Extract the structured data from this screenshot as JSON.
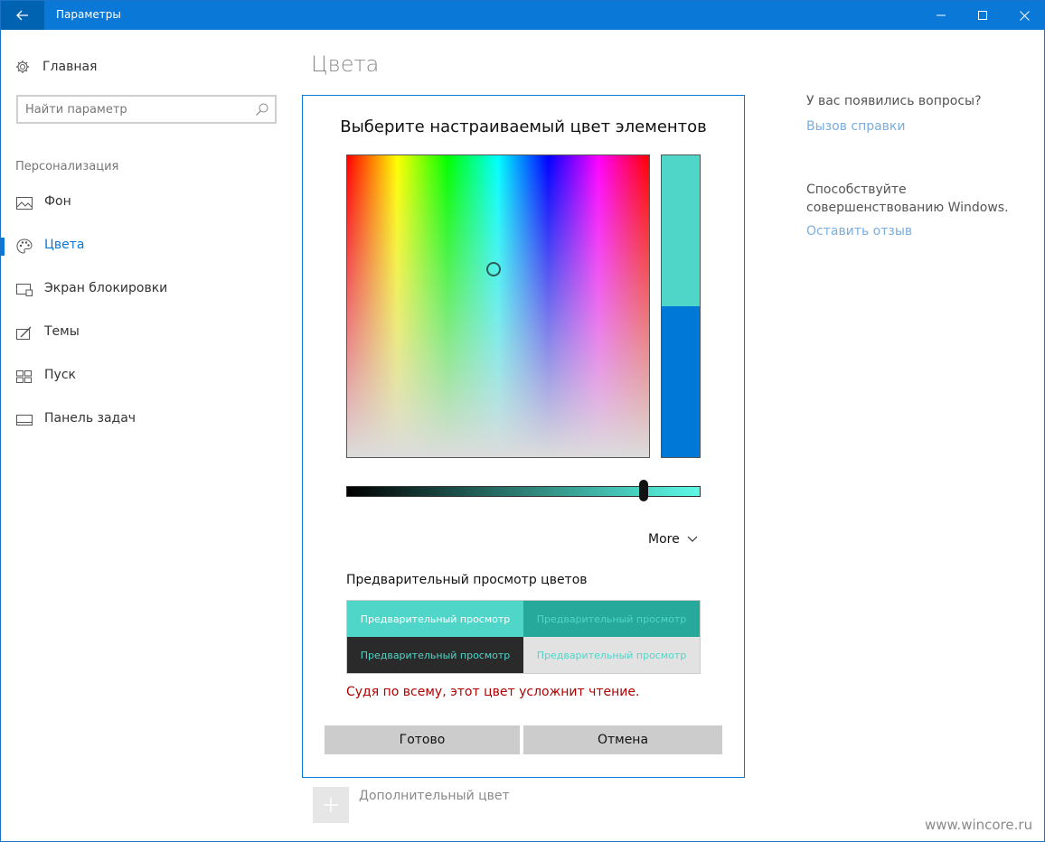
{
  "window": {
    "title": "Параметры"
  },
  "sidebar": {
    "home_label": "Главная",
    "search_placeholder": "Найти параметр",
    "section_label": "Персонализация",
    "items": [
      {
        "label": "Фон",
        "icon": "picture-icon"
      },
      {
        "label": "Цвета",
        "icon": "palette-icon",
        "active": true
      },
      {
        "label": "Экран блокировки",
        "icon": "lock-screen-icon"
      },
      {
        "label": "Темы",
        "icon": "themes-icon"
      },
      {
        "label": "Пуск",
        "icon": "start-icon"
      },
      {
        "label": "Панель задач",
        "icon": "taskbar-icon"
      }
    ]
  },
  "main": {
    "page_title": "Цвета",
    "add_color_label": "Дополнительный цвет"
  },
  "dialog": {
    "title": "Выберите настраиваемый цвет элементов",
    "more_label": "More",
    "preview_title": "Предварительный просмотр цветов",
    "preview_cells": [
      "Предварительный просмотр",
      "Предварительный просмотр",
      "Предварительный просмотр",
      "Предварительный просмотр"
    ],
    "warning": "Судя по всему, этот цвет усложнит чтение.",
    "ok_label": "Готово",
    "cancel_label": "Отмена",
    "new_color": "#4fd6c8",
    "old_color": "#0078d7",
    "brightness_level": 0.84
  },
  "right": {
    "help_question": "У вас появились вопросы?",
    "help_link": "Вызов справки",
    "feedback_text": "Способствуйте совершенствованию Windows.",
    "feedback_link": "Оставить отзыв"
  },
  "watermark": "www.wincore.ru",
  "colors": {
    "accent": "#0078d7",
    "titlebar": "#0a78d7",
    "warning": "#b00000",
    "link": "#7aaedf"
  }
}
